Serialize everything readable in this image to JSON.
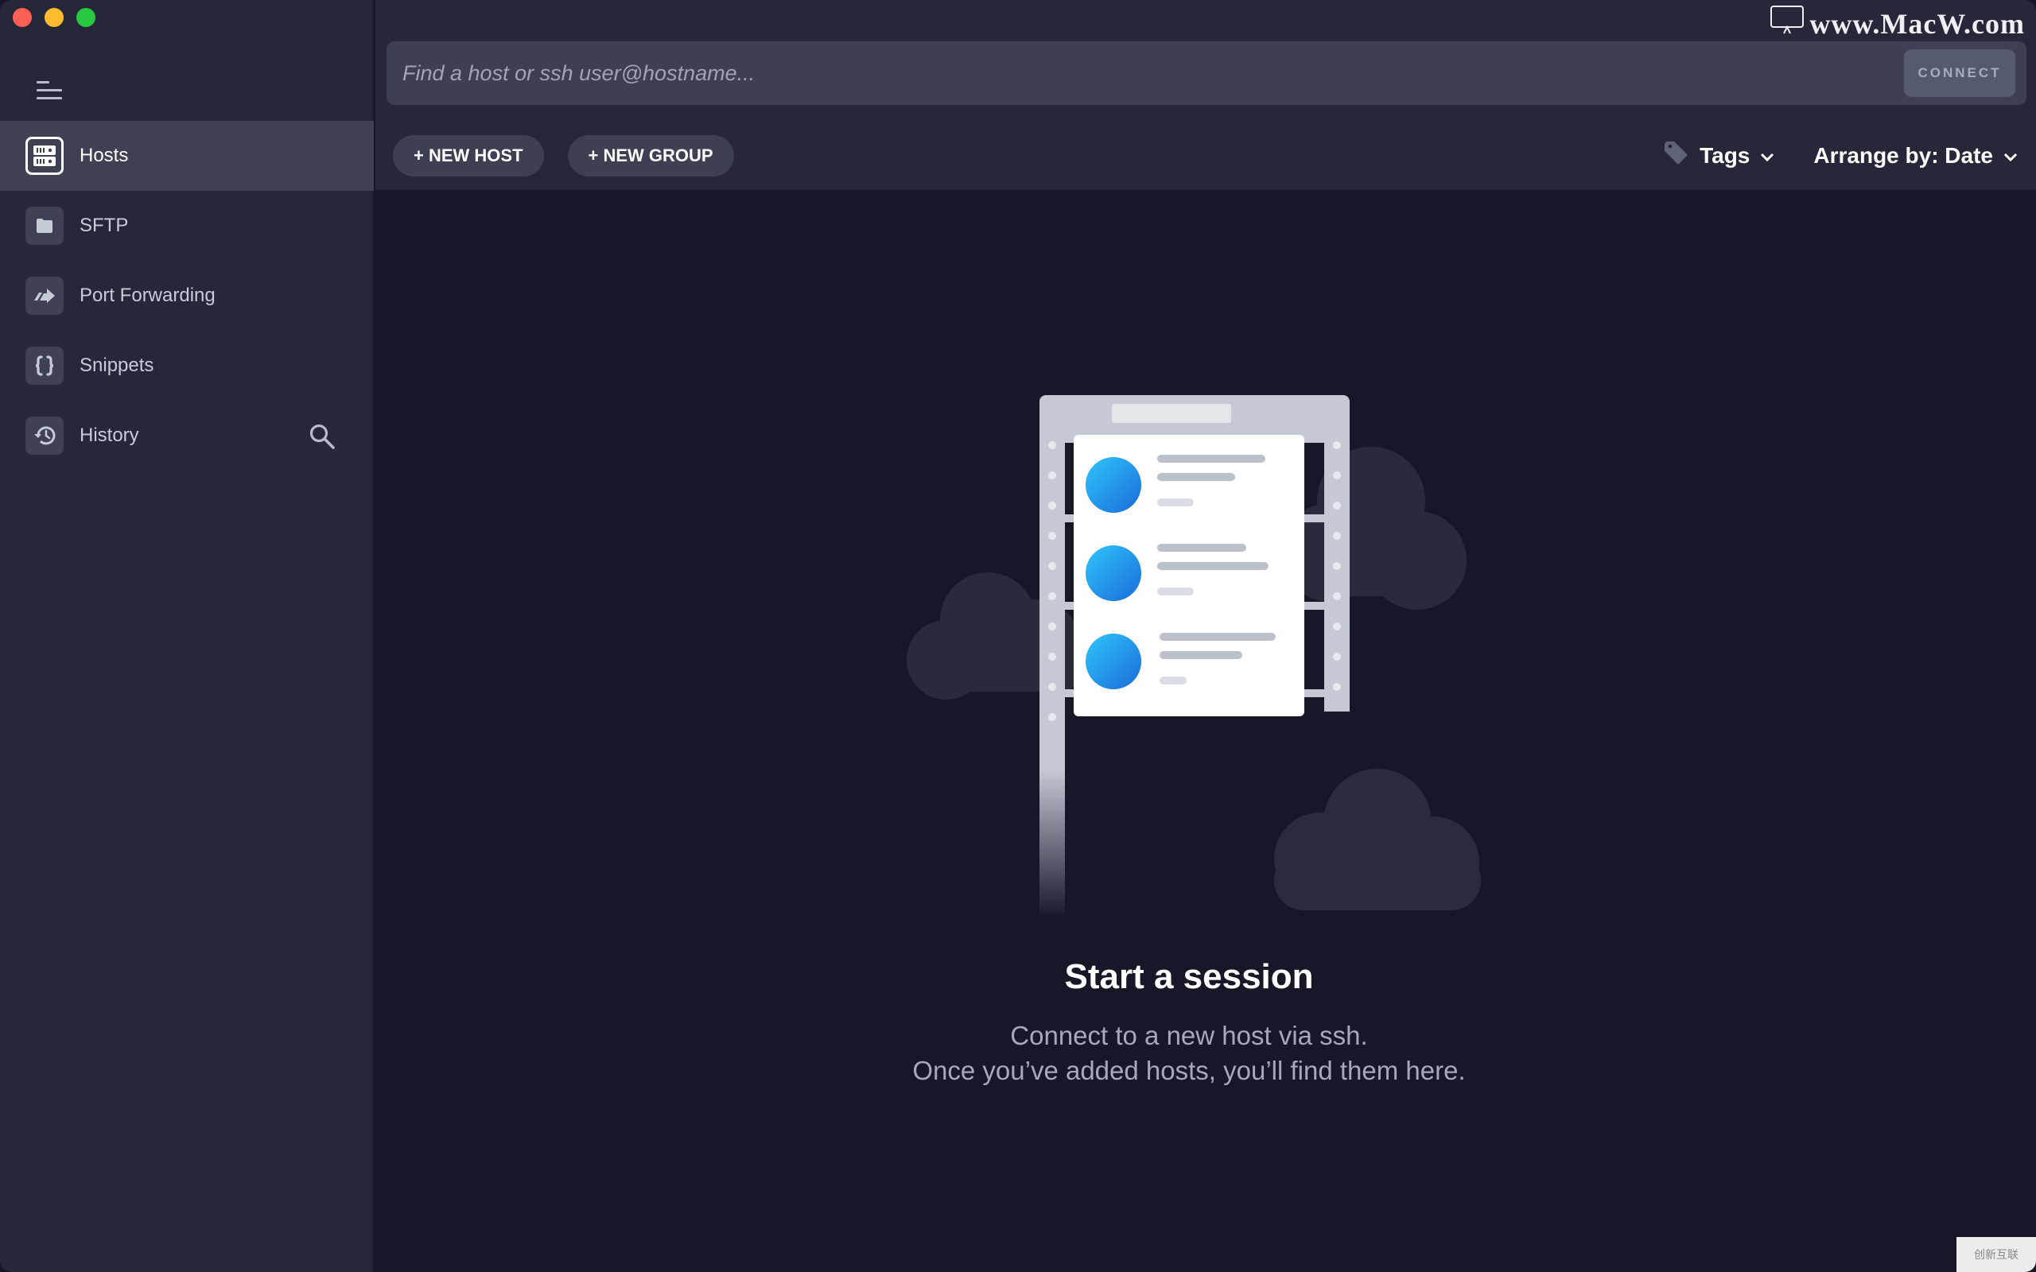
{
  "window": {
    "traffic_lights": [
      "close",
      "minimize",
      "zoom"
    ]
  },
  "sidebar": {
    "menu_icon": "hamburger-icon",
    "items": [
      {
        "label": "Hosts",
        "icon": "server-icon",
        "active": true
      },
      {
        "label": "SFTP",
        "icon": "folder-icon",
        "active": false
      },
      {
        "label": "Port Forwarding",
        "icon": "forward-arrow-icon",
        "active": false
      },
      {
        "label": "Snippets",
        "icon": "braces-icon",
        "active": false
      },
      {
        "label": "History",
        "icon": "history-icon",
        "active": false,
        "trailing_icon": "search-icon"
      }
    ]
  },
  "topbar": {
    "search": {
      "placeholder": "Find a host or ssh user@hostname...",
      "value": ""
    },
    "connect_label": "CONNECT",
    "new_host_label": "+ NEW HOST",
    "new_group_label": "+ NEW GROUP",
    "tags_label": "Tags",
    "arrange_label": "Arrange by: Date"
  },
  "empty_state": {
    "title": "Start a session",
    "line1": "Connect to a new host via ssh.",
    "line2": "Once you’ve added hosts, you’ll find them here."
  },
  "watermark": {
    "text": "www.MacW.com",
    "corner_badge": "创新互联"
  },
  "colors": {
    "sidebar_bg": "#262738",
    "main_bg": "#161827",
    "active_item_bg": "#3e4154",
    "accent_blue": "#1e8fe8"
  }
}
